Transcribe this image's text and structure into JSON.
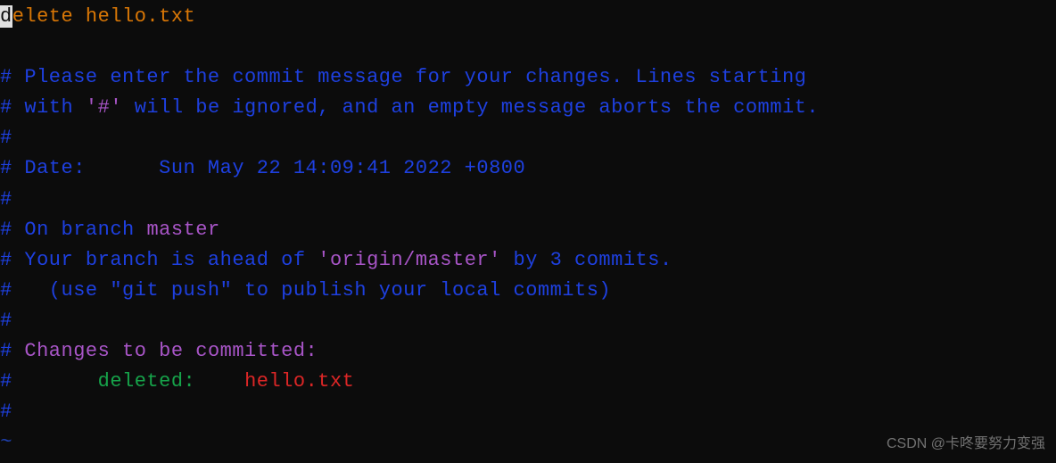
{
  "commit_msg_first_char": "d",
  "commit_msg_rest": "elete hello.txt",
  "comment_lines": {
    "l1": "# Please enter the commit message for your changes. Lines starting",
    "l2_prefix": "# with ",
    "l2_quote_hash": "'#'",
    "l2_suffix": " will be ignored, and an empty message aborts the commit.",
    "l3": "#",
    "l4": "# Date:      Sun May 22 14:09:41 2022 +0800",
    "l5": "#",
    "l6_prefix": "# On branch ",
    "l6_branch": "master",
    "l7_prefix": "# Your branch is ahead of ",
    "l7_remote": "'origin/master'",
    "l7_suffix": " by 3 commits.",
    "l8": "#   (use \"git push\" to publish your local commits)",
    "l9": "#",
    "l10_prefix": "# ",
    "l10_text": "Changes to be committed:",
    "l11_prefix": "#       ",
    "l11_deleted": "deleted:",
    "l11_spaces": "    ",
    "l11_file": "hello.txt",
    "l12": "#"
  },
  "tilde": "~",
  "watermark": "CSDN @卡咚要努力变强"
}
